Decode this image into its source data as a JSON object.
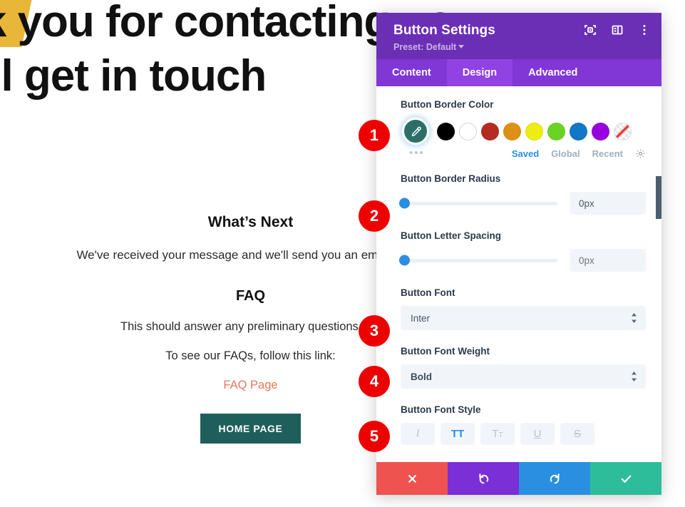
{
  "page": {
    "hero_line1": "nk you for contacting us",
    "hero_line2": "e'll get in touch",
    "whats_next_title": "What’s Next",
    "whats_next_body": "We've received your message and we'll send you an email within",
    "faq_title": "FAQ",
    "faq_body": "This should answer any preliminary questions you",
    "faq_followup": "To see our FAQs, follow this link:",
    "faq_link": "FAQ Page",
    "home_button": "HOME PAGE",
    "colors": {
      "gold": "#e8b639",
      "link": "#e8775b",
      "home_button_bg": "#1f5f5b"
    }
  },
  "modal": {
    "title": "Button Settings",
    "preset": "Preset: Default",
    "header_icons": [
      {
        "name": "focus-target-icon"
      },
      {
        "name": "layout-panel-icon"
      },
      {
        "name": "more-vertical-icon"
      }
    ],
    "tabs": [
      {
        "label": "Content",
        "active": false
      },
      {
        "label": "Design",
        "active": true
      },
      {
        "label": "Advanced",
        "active": false
      }
    ],
    "accent": "#6b2fb5",
    "tab_bar_bg": "#8136d6",
    "tab_active_bg": "#9042e3"
  },
  "border_color": {
    "label": "Button Border Color",
    "selected_value": "#2c6f68",
    "swatches": [
      "#000000",
      "#ffffff",
      "#b32c22",
      "#dd9114",
      "#eded12",
      "#6ad425",
      "#1277c6",
      "#9800e0"
    ],
    "transparent_label": "none",
    "more_dots": "•••",
    "tabs": [
      {
        "label": "Saved",
        "active": true
      },
      {
        "label": "Global",
        "active": false
      },
      {
        "label": "Recent",
        "active": false
      }
    ],
    "gear_name": "color-settings-gear-icon"
  },
  "border_radius": {
    "label": "Button Border Radius",
    "value": "0px",
    "knob_percent": 0
  },
  "letter_spacing": {
    "label": "Button Letter Spacing",
    "value": "0px",
    "placeholder": "0px",
    "knob_percent": 0
  },
  "button_font": {
    "label": "Button Font",
    "value": "Inter"
  },
  "button_font_weight": {
    "label": "Button Font Weight",
    "value": "Bold"
  },
  "button_font_style": {
    "label": "Button Font Style",
    "buttons": [
      {
        "name": "italic",
        "glyph": "I",
        "active": false
      },
      {
        "name": "uppercase",
        "glyph": "TT",
        "active": true
      },
      {
        "name": "small-caps",
        "glyph": "T",
        "active": false
      },
      {
        "name": "underline",
        "glyph": "U",
        "active": false
      },
      {
        "name": "strikethrough",
        "glyph": "S",
        "active": false
      }
    ]
  },
  "footer": {
    "buttons": [
      {
        "name": "cancel",
        "icon": "x-icon",
        "color": "#ef5350"
      },
      {
        "name": "undo",
        "icon": "undo-icon",
        "color": "#7b2fd6"
      },
      {
        "name": "redo",
        "icon": "redo-icon",
        "color": "#2a8fe0"
      },
      {
        "name": "save",
        "icon": "check-icon",
        "color": "#2ebd9a"
      }
    ]
  },
  "steps": [
    {
      "number": "1"
    },
    {
      "number": "2"
    },
    {
      "number": "3"
    },
    {
      "number": "4"
    },
    {
      "number": "5"
    }
  ]
}
